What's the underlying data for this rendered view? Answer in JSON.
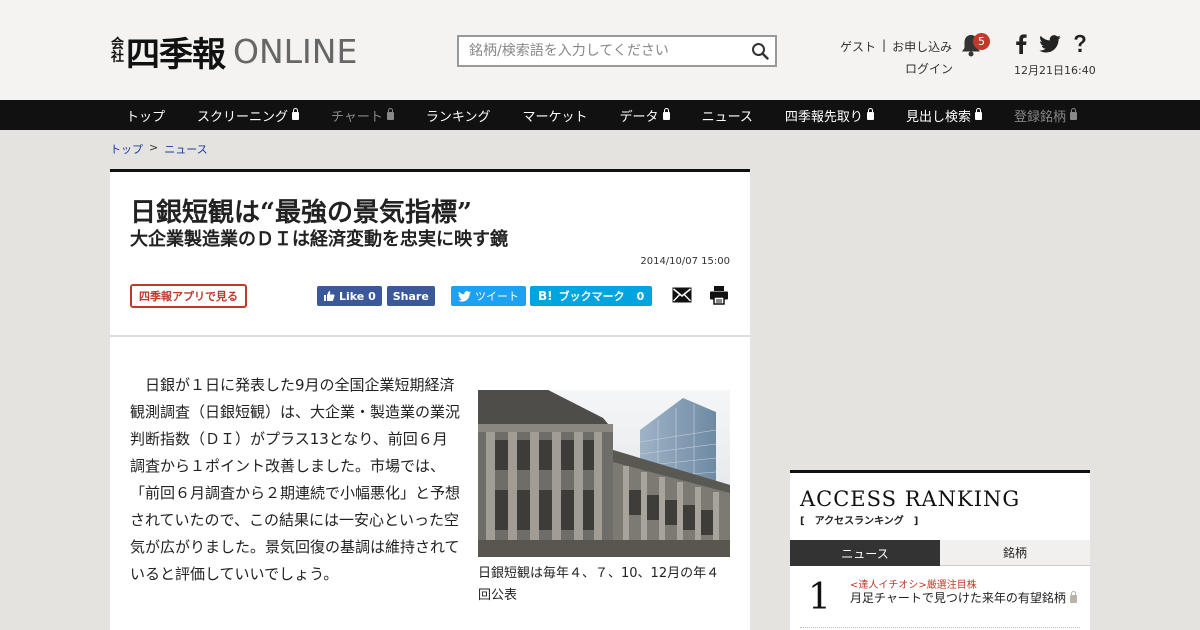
{
  "header": {
    "logo_kaisha_1": "会",
    "logo_kaisha_2": "社",
    "logo_shiki": "四季報",
    "logo_online": "ONLINE",
    "search_placeholder": "銘柄/検索語を入力してください",
    "guest": "ゲスト",
    "separator": "|",
    "signup": "お申し込み",
    "login": "ログイン",
    "notification_count": "5",
    "datetime": "12月21日16:40"
  },
  "nav": {
    "items": [
      {
        "label": "トップ",
        "locked": false,
        "dim": false
      },
      {
        "label": "スクリーニング",
        "locked": true,
        "dim": false
      },
      {
        "label": "チャート",
        "locked": true,
        "dim": true
      },
      {
        "label": "ランキング",
        "locked": false,
        "dim": false
      },
      {
        "label": "マーケット",
        "locked": false,
        "dim": false
      },
      {
        "label": "データ",
        "locked": true,
        "dim": false
      },
      {
        "label": "ニュース",
        "locked": false,
        "dim": false
      },
      {
        "label": "四季報先取り",
        "locked": true,
        "dim": false
      },
      {
        "label": "見出し検索",
        "locked": true,
        "dim": false
      },
      {
        "label": "登録銘柄",
        "locked": true,
        "dim": true
      }
    ]
  },
  "breadcrumb": {
    "home": "トップ",
    "sep": ">",
    "current": "ニュース"
  },
  "article": {
    "title": "日銀短観は“最強の景気指標”",
    "subtitle": "大企業製造業のＤＩは経済変動を忠実に映す鏡",
    "date": "2014/10/07 15:00",
    "app_button": "四季報アプリで見る",
    "fb_like": "Like 0",
    "fb_share": "Share",
    "tweet": "ツイート",
    "hatena": "ブックマーク",
    "hatena_count": "0",
    "body": "日銀が１日に発表した9月の全国企業短期経済観測調査（日銀短観）は、大企業・製造業の業況判断指数（ＤＩ）がプラス13となり、前回６月調査から１ポイント改善しました。市場では、「前回６月調査から２期連続で小幅悪化」と予想されていたので、この結果には一安心といった空気が広がりました。景気回復の基調は維持されていると評価していいでしょう。",
    "caption": "日銀短観は毎年４、７、10、12月の年４回公表"
  },
  "ranking": {
    "title": "ACCESS RANKING",
    "subtitle": "[　アクセスランキング　]",
    "tab_news": "ニュース",
    "tab_stock": "銘柄",
    "items": [
      {
        "rank": "1",
        "tag": "<達人イチオシ>厳選注目株",
        "headline": "月足チャートで見つけた来年の有望銘柄"
      }
    ]
  },
  "colors": {
    "accent_red": "#c0392b",
    "nav_bg": "#111111",
    "facebook": "#3b5998",
    "twitter": "#1da1f2",
    "hatena": "#00a4de"
  }
}
